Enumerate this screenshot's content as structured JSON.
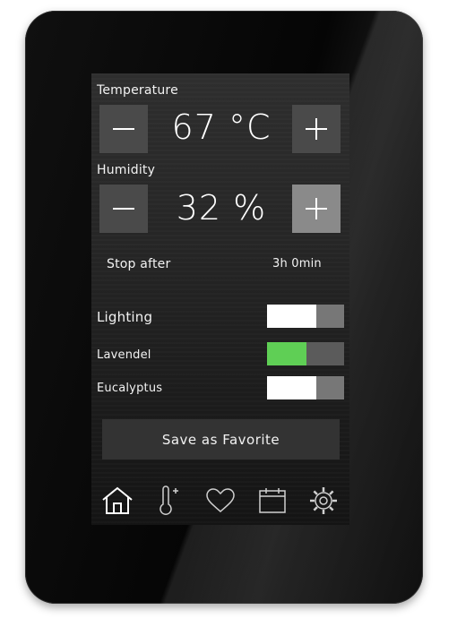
{
  "temperature": {
    "label": "Temperature",
    "value": "67 °C",
    "decrease_icon": "minus-icon",
    "increase_icon": "plus-icon"
  },
  "humidity": {
    "label": "Humidity",
    "value": "32 %",
    "decrease_icon": "minus-icon",
    "increase_icon": "plus-icon"
  },
  "stop_after": {
    "label": "Stop after",
    "value": "3h 0min"
  },
  "toggles": [
    {
      "label": "Lighting",
      "state": "off"
    },
    {
      "label": "Lavendel",
      "state": "on"
    },
    {
      "label": "Eucalyptus",
      "state": "off"
    }
  ],
  "save_label": "Save as Favorite",
  "nav": [
    {
      "icon": "home-icon",
      "active": true
    },
    {
      "icon": "thermometer-plus-icon",
      "active": false
    },
    {
      "icon": "heart-icon",
      "active": false
    },
    {
      "icon": "calendar-icon",
      "active": false
    },
    {
      "icon": "gear-icon",
      "active": false
    }
  ],
  "colors": {
    "toggle_on": "#5fcf55",
    "button": "#4a4a4a",
    "button_active": "#8a8a8a"
  }
}
